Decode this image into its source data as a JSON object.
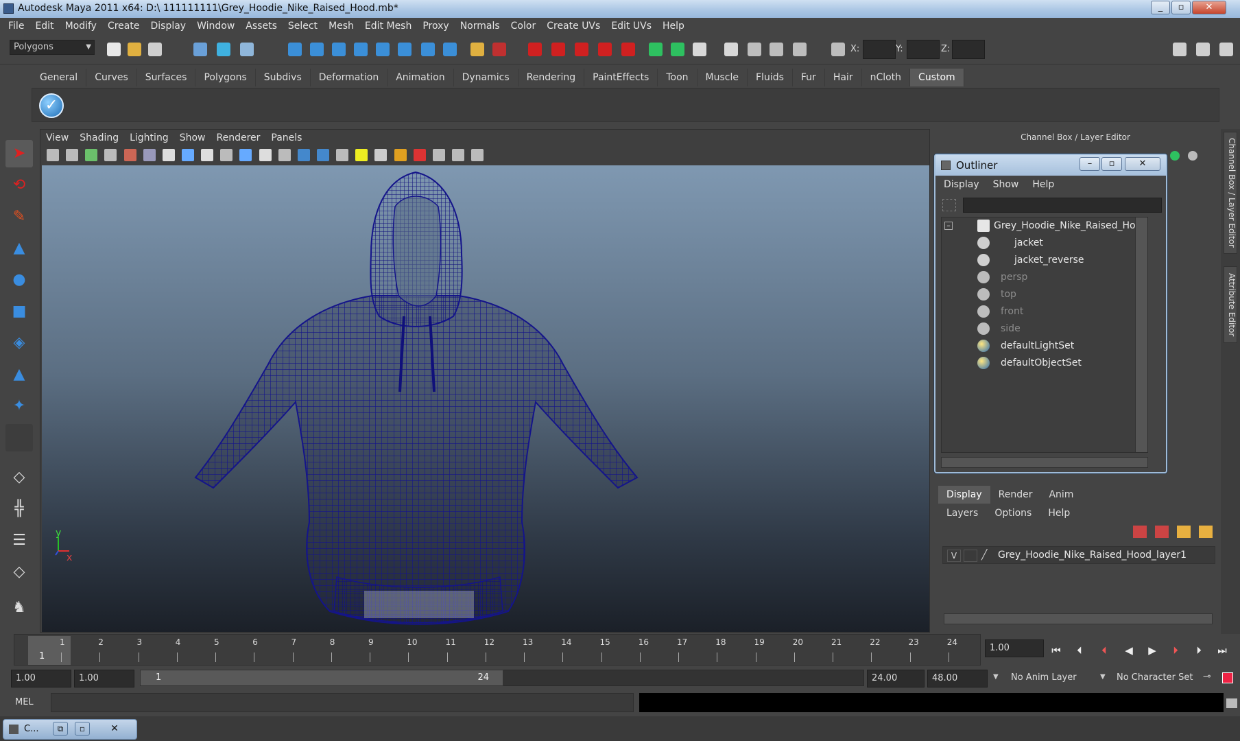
{
  "window": {
    "title": "Autodesk Maya 2011 x64: D:\\ 111111111\\Grey_Hoodie_Nike_Raised_Hood.mb*"
  },
  "menubar": [
    "File",
    "Edit",
    "Modify",
    "Create",
    "Display",
    "Window",
    "Assets",
    "Select",
    "Mesh",
    "Edit Mesh",
    "Proxy",
    "Normals",
    "Color",
    "Create UVs",
    "Edit UVs",
    "Help"
  ],
  "statusline": {
    "menuset": "Polygons",
    "x_label": "X:",
    "y_label": "Y:",
    "z_label": "Z:"
  },
  "shelf": {
    "tabs": [
      "General",
      "Curves",
      "Surfaces",
      "Polygons",
      "Subdivs",
      "Deformation",
      "Animation",
      "Dynamics",
      "Rendering",
      "PaintEffects",
      "Toon",
      "Muscle",
      "Fluids",
      "Fur",
      "Hair",
      "nCloth",
      "Custom"
    ],
    "active_tab": "Custom"
  },
  "viewport": {
    "menus": [
      "View",
      "Shading",
      "Lighting",
      "Show",
      "Renderer",
      "Panels"
    ],
    "axis_y": "y",
    "axis_x": "x"
  },
  "channelbox": {
    "header": "Channel Box / Layer Editor",
    "side_tab_1": "Channel Box / Layer Editor",
    "side_tab_2": "Attribute Editor"
  },
  "outliner": {
    "title": "Outliner",
    "menus": [
      "Display",
      "Show",
      "Help"
    ],
    "items": [
      {
        "label": "Grey_Hoodie_Nike_Raised_Hood",
        "icon": "transform-icon"
      },
      {
        "label": "jacket",
        "icon": "mesh-icon"
      },
      {
        "label": "jacket_reverse",
        "icon": "mesh-icon"
      },
      {
        "label": "persp",
        "icon": "camera-icon"
      },
      {
        "label": "top",
        "icon": "camera-icon"
      },
      {
        "label": "front",
        "icon": "camera-icon"
      },
      {
        "label": "side",
        "icon": "camera-icon"
      },
      {
        "label": "defaultLightSet",
        "icon": "set-icon"
      },
      {
        "label": "defaultObjectSet",
        "icon": "set-icon"
      }
    ]
  },
  "layereditor": {
    "tabs": [
      "Display",
      "Render",
      "Anim"
    ],
    "active_tab": "Display",
    "menus": [
      "Layers",
      "Options",
      "Help"
    ],
    "layer": {
      "visible": "V",
      "name": "Grey_Hoodie_Nike_Raised_Hood_layer1"
    }
  },
  "timeslider": {
    "ticks": [
      "1",
      "2",
      "3",
      "4",
      "5",
      "6",
      "7",
      "8",
      "9",
      "10",
      "11",
      "12",
      "13",
      "14",
      "15",
      "16",
      "17",
      "18",
      "19",
      "20",
      "21",
      "22",
      "23",
      "24"
    ],
    "current_frame": "1",
    "current_time_field": "1.00"
  },
  "rangeslider": {
    "start_time": "1.00",
    "range_start": "1.00",
    "bar_start": "1",
    "bar_end": "24",
    "range_end": "24.00",
    "end_time": "48.00",
    "anim_layer": "No Anim Layer",
    "character_set": "No Character Set"
  },
  "cmdline": {
    "label": "MEL"
  },
  "minimized": {
    "label": "C..."
  },
  "colors": {
    "wireframe": "#1a1a8c",
    "accent": "#5a5a5a"
  }
}
